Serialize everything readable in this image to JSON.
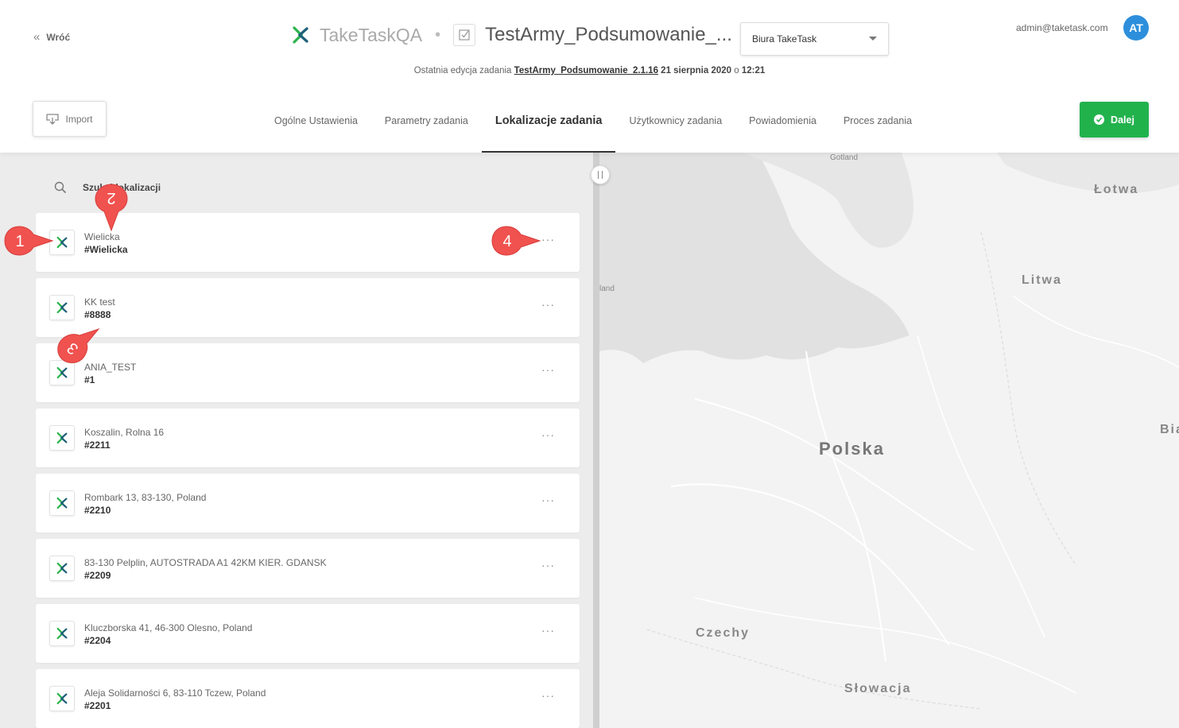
{
  "header": {
    "back_label": "Wróć",
    "app_name": "TakeTaskQA",
    "separator": "•",
    "task_name": "TestArmy_Podsumowanie_...",
    "office_select": "Biura TakeTask",
    "user_email": "admin@taketask.com",
    "avatar_initials": "AT",
    "last_edit_prefix": "Ostatnia edycja zadania",
    "last_edit_link": "TestArmy_Podsumowanie_2.1.16",
    "last_edit_date": "21 sierpnia 2020",
    "last_edit_time_sep": "o",
    "last_edit_time": "12:21"
  },
  "toolbar": {
    "import_label": "Import",
    "next_label": "Dalej"
  },
  "tabs": [
    {
      "label": "Ogólne Ustawienia",
      "active": false
    },
    {
      "label": "Parametry zadania",
      "active": false
    },
    {
      "label": "Lokalizacje zadania",
      "active": true
    },
    {
      "label": "Użytkownicy zadania",
      "active": false
    },
    {
      "label": "Powiadomienia",
      "active": false
    },
    {
      "label": "Proces zadania",
      "active": false
    }
  ],
  "search": {
    "placeholder": "Szukaj lokalizacji"
  },
  "locations": [
    {
      "name": "Wielicka",
      "code": "#Wielicka",
      "more": "···"
    },
    {
      "name": "KK test",
      "code": "#8888",
      "more": "···"
    },
    {
      "name": "ANIA_TEST",
      "code": "#1",
      "more": "···"
    },
    {
      "name": "Koszalin, Rolna 16",
      "code": "#2211",
      "more": "···"
    },
    {
      "name": "Rombark 13, 83-130, Poland",
      "code": "#2210",
      "more": "···"
    },
    {
      "name": "83-130 Pelplin, AUTOSTRADA A1 42KM KIER. GDANSK",
      "code": "#2209",
      "more": "···"
    },
    {
      "name": "Kluczborska 41, 46-300 Olesno, Poland",
      "code": "#2204",
      "more": "···"
    },
    {
      "name": "Aleja Solidarności 6, 83-110 Tczew, Poland",
      "code": "#2201",
      "more": "···"
    }
  ],
  "map": {
    "labels": {
      "gotland": "Gotland",
      "lotwa": "Łotwa",
      "litwa": "Litwa",
      "land": "land",
      "polska": "Polska",
      "bia": "Bia",
      "czechy": "Czechy",
      "slowacja": "Słowacja"
    }
  },
  "annotations": {
    "m1": "1",
    "m2": "2",
    "m3": "3",
    "m4": "4"
  },
  "colors": {
    "accent_green": "#22b24c",
    "avatar_blue": "#2d8fdc",
    "marker_red": "#f0524f",
    "logo_green": "#2bb34b",
    "logo_teal": "#1d5f7a"
  }
}
